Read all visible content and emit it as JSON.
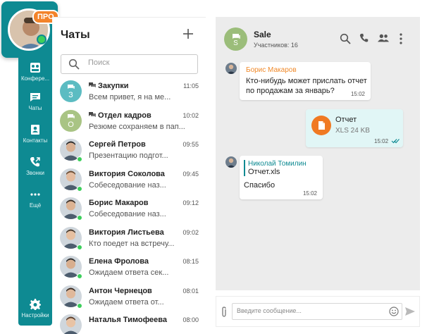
{
  "profile": {
    "badge": "ПРО"
  },
  "nav": [
    {
      "label": "Конфере...",
      "icon": "conference-icon"
    },
    {
      "label": "Чаты",
      "icon": "chat-bubble-icon"
    },
    {
      "label": "Контакты",
      "icon": "contacts-icon"
    },
    {
      "label": "Звонки",
      "icon": "phone-icon"
    },
    {
      "label": "Ещё",
      "icon": "more-dots-icon"
    },
    {
      "label": "Настройки",
      "icon": "gear-icon"
    }
  ],
  "chatlist": {
    "title": "Чаты",
    "add_icon": "plus-icon",
    "search_placeholder": "Поиск",
    "items": [
      {
        "name": "Закупки",
        "group": true,
        "letter": "З",
        "avatar_color": "#5cbcc2",
        "time": "11:05",
        "preview": "Всем привет, я на ме..."
      },
      {
        "name": "Отдел кадров",
        "group": true,
        "letter": "О",
        "avatar_color": "#a9c484",
        "time": "10:02",
        "preview": "Резюме сохраняем в пап..."
      },
      {
        "name": "Сергей Петров",
        "group": false,
        "online": true,
        "time": "09:55",
        "preview": "Презентацию подгот..."
      },
      {
        "name": "Виктория Соколова",
        "group": false,
        "online": true,
        "time": "09:45",
        "preview": "Собеседование наз..."
      },
      {
        "name": "Борис Макаров",
        "group": false,
        "online": true,
        "time": "09:12",
        "preview": "Собеседование наз..."
      },
      {
        "name": "Виктория Листьева",
        "group": false,
        "online": true,
        "time": "09:02",
        "preview": "Кто поедет на встречу..."
      },
      {
        "name": "Елена Фролова",
        "group": false,
        "online": true,
        "time": "08:15",
        "preview": "Ожидаем ответа сек..."
      },
      {
        "name": "Антон Чернецов",
        "group": false,
        "online": true,
        "time": "08:01",
        "preview": "Ожидаем ответа от..."
      },
      {
        "name": "Наталья Тимофеева",
        "group": false,
        "online": false,
        "time": "08:00",
        "preview": ""
      }
    ]
  },
  "conversation": {
    "title": "Sale",
    "subtitle": "Участников: 16",
    "avatar_letter": "S",
    "messages": [
      {
        "author": "Борис Макаров",
        "text": "Кто-нибудь может прислать отчет по продажам за январь?",
        "time": "15:02"
      },
      {
        "file_name": "Отчет",
        "file_meta": "XLS 24 KB",
        "time": "15:02"
      },
      {
        "quote_author": "Николай Томилин",
        "quote_text": "Отчет.xls",
        "text": "Спасибо",
        "time": "15:02"
      }
    ]
  },
  "composer": {
    "placeholder": "Введите сообщение..."
  },
  "colors": {
    "accent": "#0e8a92",
    "badge": "#f3832a",
    "online": "#3ccf5b",
    "author": "#f08a2b"
  }
}
